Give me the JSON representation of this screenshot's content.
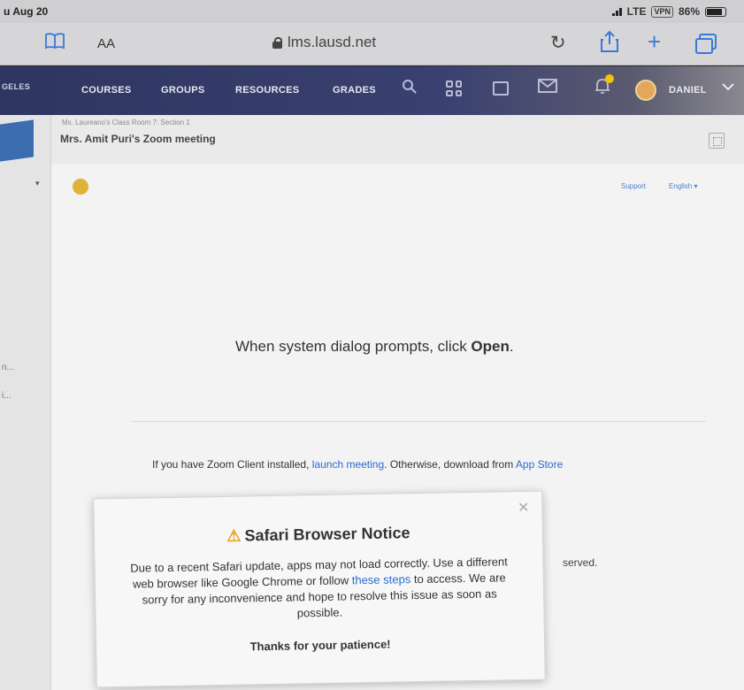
{
  "status_bar": {
    "time": "u Aug 20",
    "network": "LTE",
    "vpn": "VPN",
    "battery": "86%",
    "battery_level": 0.86
  },
  "browser": {
    "url": "lms.lausd.net",
    "aa_label": "AA"
  },
  "nav": {
    "logo_text": "GELES",
    "items": [
      "COURSES",
      "GROUPS",
      "RESOURCES",
      "GRADES"
    ],
    "user": "DANIEL"
  },
  "page": {
    "breadcrumb": "Ms. Laureano's Class Room 7: Section 1",
    "title": "Mrs. Amit Puri's Zoom meeting",
    "left_ellipsis_1": "n...",
    "left_ellipsis_2": "i..."
  },
  "zoom": {
    "support": "Support",
    "language": "English",
    "prompt_prefix": "When system dialog prompts, click ",
    "prompt_bold": "Open",
    "prompt_suffix": ".",
    "launch_prefix": "If you have Zoom Client installed, ",
    "launch_link": "launch meeting",
    "launch_middle": ". Otherwise, download from ",
    "store_link": "App Store",
    "reserved": "served."
  },
  "notice": {
    "title": "Safari Browser Notice",
    "body_prefix": "Due to a recent Safari update, apps may not load correctly. Use a different web browser like Google Chrome or follow ",
    "body_link": "these steps",
    "body_suffix": " to access. We are sorry for any inconvenience and hope to resolve this issue as soon as possible.",
    "thanks": "Thanks for your patience!"
  }
}
